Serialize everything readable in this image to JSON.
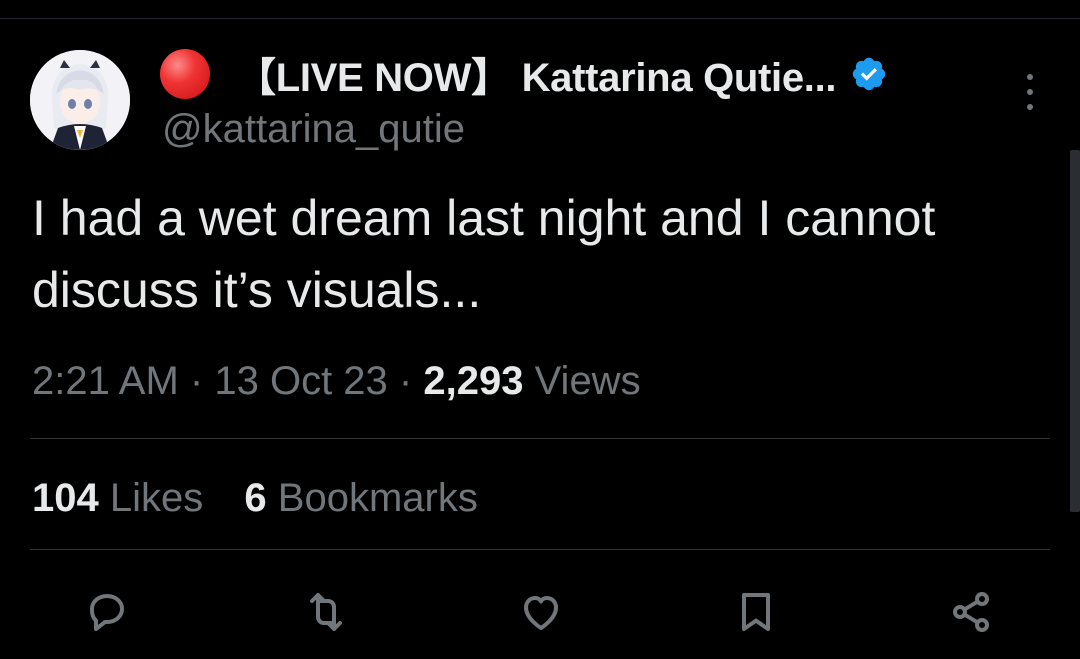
{
  "tweet": {
    "author": {
      "display_name": "【LIVE NOW】 Kattarina Qutie...",
      "handle": "@kattarina_qutie",
      "verified": true,
      "status_icon": "red-circle"
    },
    "text_line_1": "I had a wet dream last night and I cannot",
    "text_line_2": "discuss it’s visuals...",
    "time": "2:21 AM",
    "date": "13 Oct 23",
    "views_count": "2,293",
    "views_label": "Views",
    "likes_count": "104",
    "likes_label": "Likes",
    "bookmarks_count": "6",
    "bookmarks_label": "Bookmarks"
  },
  "separator": "·",
  "actions": [
    "reply-icon",
    "retweet-icon",
    "like-icon",
    "bookmark-icon",
    "share-icon"
  ],
  "colors": {
    "background": "#000000",
    "primary_text": "#e7e9ea",
    "secondary_text": "#71767b",
    "verified_badge": "#1d9bf0",
    "live_dot": "#e0201f",
    "divider": "#2f3336"
  }
}
